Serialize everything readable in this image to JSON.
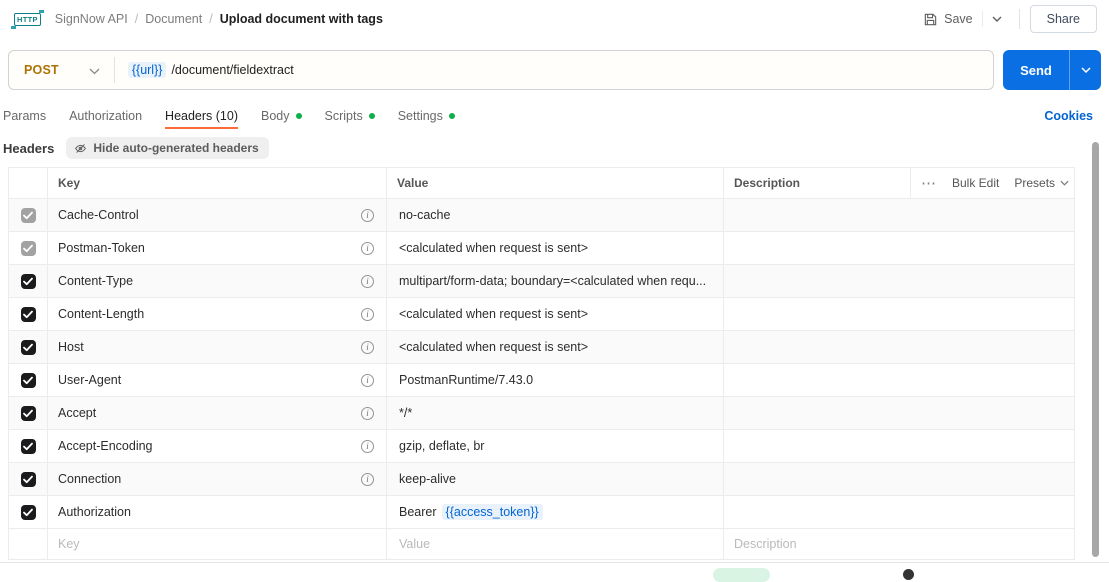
{
  "colors": {
    "method_orange": "#ab7303",
    "send_blue": "#0b6fe4",
    "link_blue": "#0265d2",
    "tab_underline_orange": "#ff6c37",
    "dot_green": "#0caf49",
    "var_pill_bg": "#e9f1fb",
    "row_alt_bg": "#fafafa",
    "checkbox_dark": "#1b1b1d",
    "checkbox_gray": "#a2a2a2",
    "http_icon_teal": "#0e7f8a"
  },
  "topbar": {
    "http_badge": "HTTP",
    "breadcrumb": [
      "SignNow API",
      "Document",
      "Upload document with tags"
    ],
    "save_label": "Save",
    "share_label": "Share"
  },
  "request": {
    "method": "POST",
    "url_var": "{{url}}",
    "url_path": "/document/fieldextract",
    "send_label": "Send"
  },
  "tabs": {
    "items": [
      {
        "label": "Params",
        "active": false,
        "dot": false
      },
      {
        "label": "Authorization",
        "active": false,
        "dot": false
      },
      {
        "label": "Headers",
        "count": "(10)",
        "active": true,
        "dot": false
      },
      {
        "label": "Body",
        "active": false,
        "dot": true
      },
      {
        "label": "Scripts",
        "active": false,
        "dot": true
      },
      {
        "label": "Settings",
        "active": false,
        "dot": true
      }
    ],
    "cookies_label": "Cookies"
  },
  "headers_section": {
    "title": "Headers",
    "toggle_label": "Hide auto-generated headers"
  },
  "table": {
    "columns": {
      "key": "Key",
      "value": "Value",
      "description": "Description"
    },
    "actions": {
      "more_icon": "⋯",
      "bulk_edit_label": "Bulk Edit",
      "presets_label": "Presets"
    },
    "rows": [
      {
        "key": "Cache-Control",
        "value": "no-cache",
        "checked": true,
        "auto": true,
        "info": true
      },
      {
        "key": "Postman-Token",
        "value": "<calculated when request is sent>",
        "checked": true,
        "auto": true,
        "info": true
      },
      {
        "key": "Content-Type",
        "value": "multipart/form-data; boundary=<calculated when requ...",
        "checked": true,
        "auto": false,
        "info": true
      },
      {
        "key": "Content-Length",
        "value": "<calculated when request is sent>",
        "checked": true,
        "auto": false,
        "info": true
      },
      {
        "key": "Host",
        "value": "<calculated when request is sent>",
        "checked": true,
        "auto": false,
        "info": true
      },
      {
        "key": "User-Agent",
        "value": "PostmanRuntime/7.43.0",
        "checked": true,
        "auto": false,
        "info": true
      },
      {
        "key": "Accept",
        "value": "*/*",
        "checked": true,
        "auto": false,
        "info": true
      },
      {
        "key": "Accept-Encoding",
        "value": "gzip, deflate, br",
        "checked": true,
        "auto": false,
        "info": true
      },
      {
        "key": "Connection",
        "value": "keep-alive",
        "checked": true,
        "auto": false,
        "info": true
      },
      {
        "key": "Authorization",
        "value_prefix": "Bearer",
        "value_var": "{{access_token}}",
        "checked": true,
        "auto": false,
        "info": false
      }
    ],
    "empty_row": {
      "key_placeholder": "Key",
      "value_placeholder": "Value",
      "description_placeholder": "Description"
    }
  }
}
